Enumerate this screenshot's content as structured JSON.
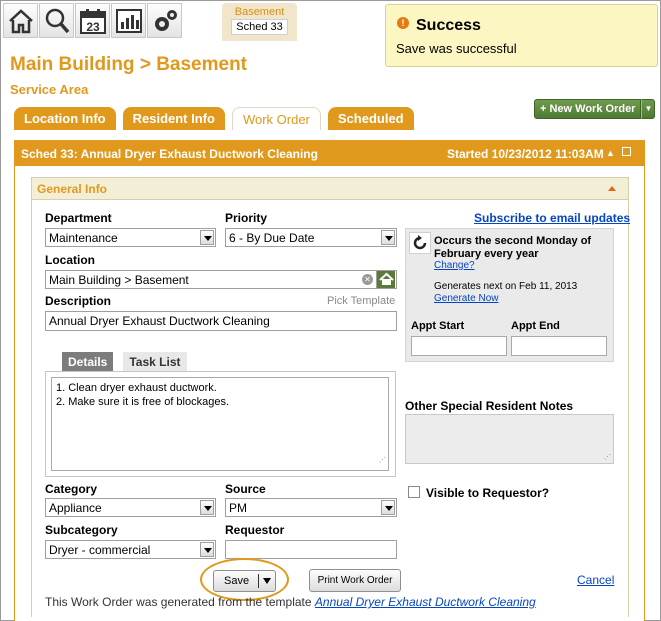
{
  "toolbar": {
    "icons": [
      "home-icon",
      "search-icon",
      "calendar-icon",
      "reports-icon",
      "settings-icon"
    ],
    "calendar_day": "23"
  },
  "location_tab": {
    "name": "Basement",
    "badge": "Sched 33"
  },
  "toast": {
    "title": "Success",
    "message": "Save was successful"
  },
  "header": {
    "title": "Main Building > Basement",
    "subtitle": "Service Area"
  },
  "new_wo_label": "+ New Work Order",
  "tabs": [
    {
      "label": "Location Info",
      "active": false
    },
    {
      "label": "Resident Info",
      "active": false
    },
    {
      "label": "Work Order",
      "active": true
    },
    {
      "label": "Scheduled",
      "active": false
    }
  ],
  "panel": {
    "title": "Sched 33: Annual Dryer Exhaust Ductwork Cleaning",
    "started": "Started 10/23/2012 11:03AM"
  },
  "general_info": {
    "title": "General Info",
    "department_label": "Department",
    "department_value": "Maintenance",
    "priority_label": "Priority",
    "priority_value": "6 - By Due Date",
    "subscribe_link": "Subscribe to email updates",
    "location_label": "Location",
    "location_value": "Main Building > Basement",
    "description_label": "Description",
    "pick_template": "Pick Template",
    "description_value": "Annual Dryer Exhaust Ductwork Cleaning"
  },
  "schedule": {
    "occurs": "Occurs the second Monday of February every year",
    "change_link": "Change?",
    "generates": "Generates next on Feb 11, 2013",
    "generate_link": "Generate Now",
    "appt_start_label": "Appt Start",
    "appt_end_label": "Appt End"
  },
  "details": {
    "tab_details": "Details",
    "tab_tasklist": "Task List",
    "line1": "1. Clean dryer exhaust ductwork.",
    "line2": "2. Make sure it is free of blockages."
  },
  "notes_label": "Other Special Resident Notes",
  "category": {
    "label": "Category",
    "value": "Appliance"
  },
  "source": {
    "label": "Source",
    "value": "PM"
  },
  "subcategory": {
    "label": "Subcategory",
    "value": "Dryer - commercial"
  },
  "requestor": {
    "label": "Requestor",
    "value": ""
  },
  "visible_label": "Visible to Requestor?",
  "actions": {
    "save": "Save",
    "print": "Print Work Order",
    "cancel": "Cancel"
  },
  "footer": {
    "text": "This Work Order was generated from the template",
    "link": "Annual Dryer Exhaust Ductwork Cleaning"
  }
}
